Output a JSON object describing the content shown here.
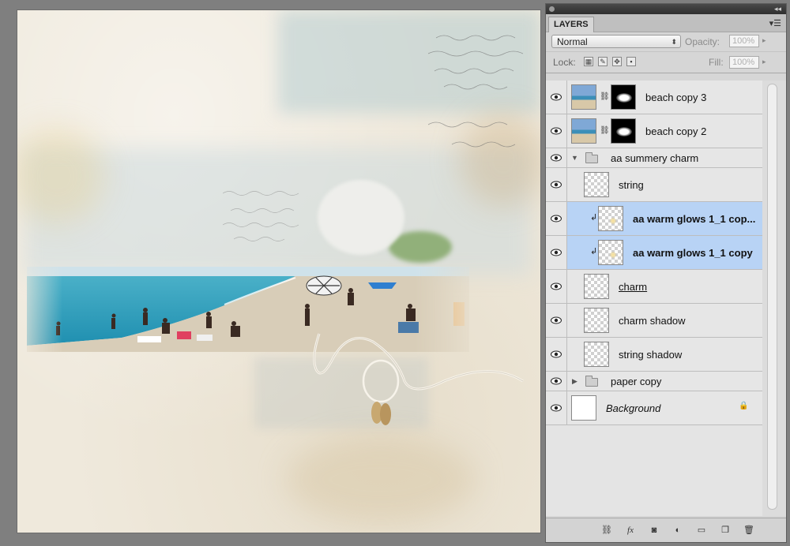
{
  "panel": {
    "tab_label": "LAYERS",
    "blend_mode": "Normal",
    "opacity_label": "Opacity:",
    "opacity_value": "100%",
    "lock_label": "Lock:",
    "fill_label": "Fill:",
    "fill_value": "100%"
  },
  "layers": [
    {
      "name": "beach copy 3"
    },
    {
      "name": "beach copy 2"
    },
    {
      "name": "aa summery charm"
    },
    {
      "name": "string"
    },
    {
      "name": "aa warm glows 1_1 cop..."
    },
    {
      "name": "aa warm glows 1_1 copy"
    },
    {
      "name": "charm"
    },
    {
      "name": "charm shadow"
    },
    {
      "name": "string shadow"
    },
    {
      "name": "paper copy"
    },
    {
      "name": "Background"
    }
  ],
  "colors": {
    "selection": "#b8d3f5",
    "panel_bg": "#d6d6d6",
    "workspace_bg": "#7f7f7f"
  },
  "icons": {
    "visibility": "eye-icon",
    "link": "chain-link-icon",
    "group": "folder-icon",
    "locked": "lock-icon",
    "footer": [
      "link-layers-icon",
      "fx-icon",
      "add-mask-icon",
      "adjustment-layer-icon",
      "new-group-icon",
      "new-layer-icon",
      "trash-icon"
    ]
  }
}
